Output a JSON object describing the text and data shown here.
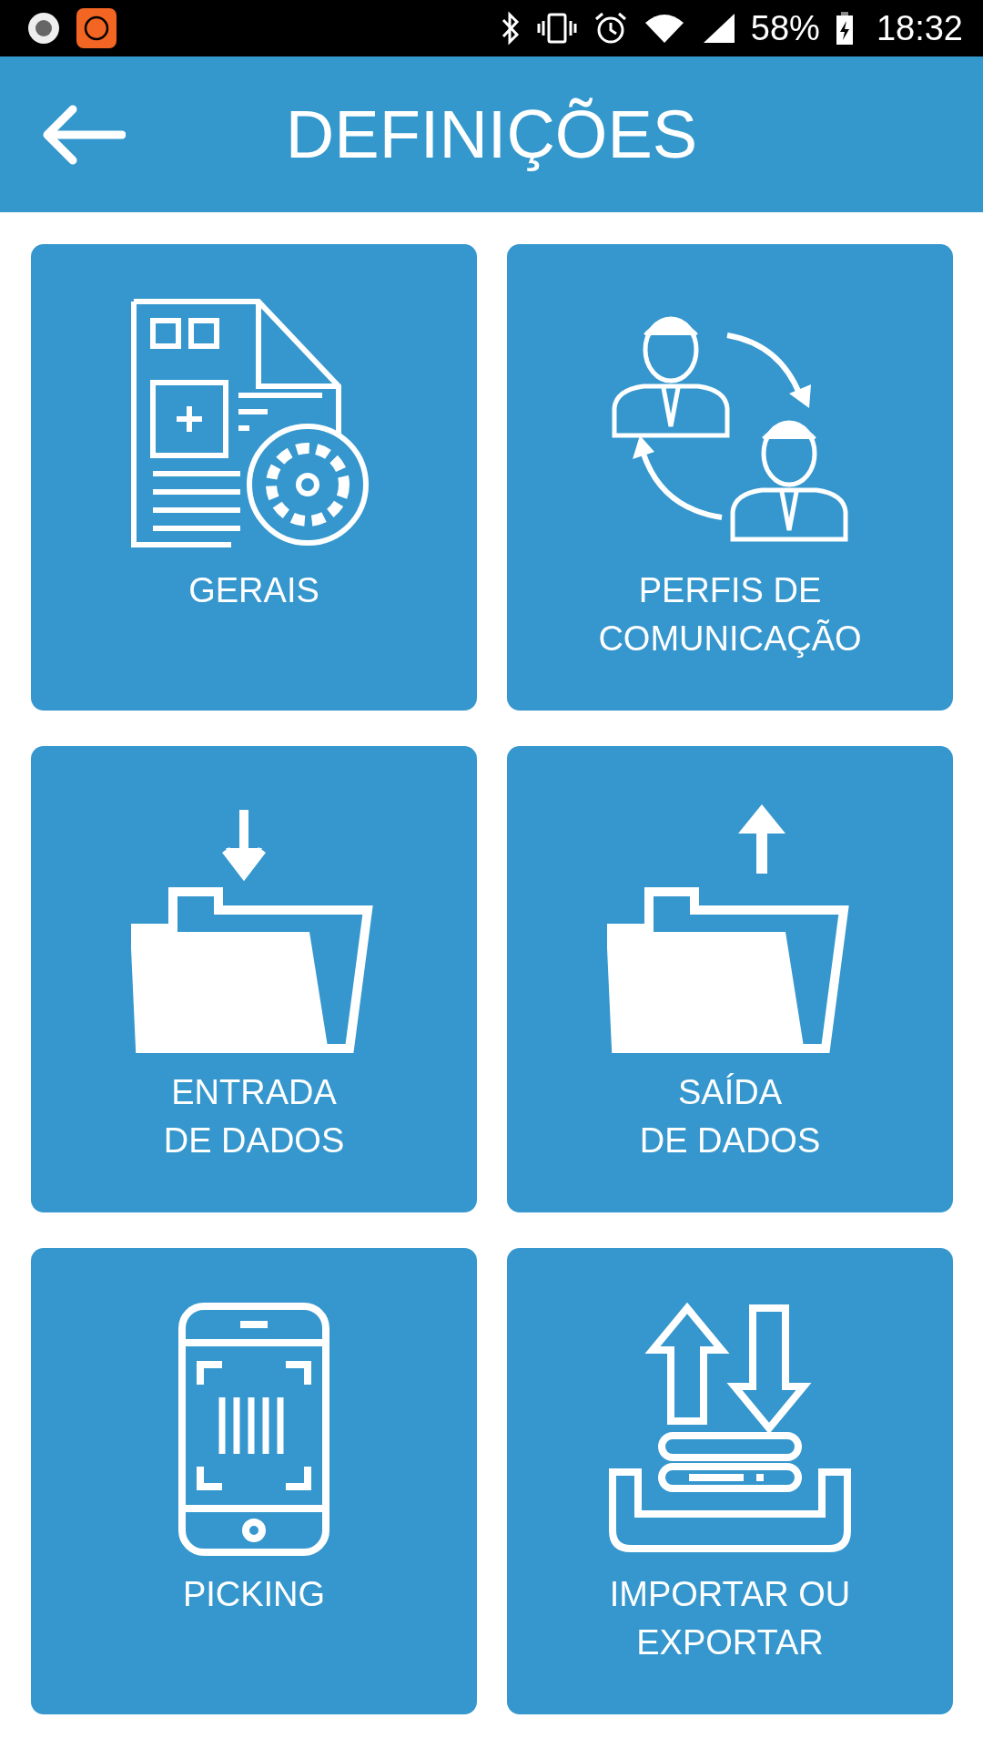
{
  "status_bar": {
    "battery": "58%",
    "time": "18:32"
  },
  "header": {
    "title": "DEFINIÇÕES"
  },
  "tiles": [
    {
      "label": "GERAIS"
    },
    {
      "label": "PERFIS DE\nCOMUNICAÇÃO"
    },
    {
      "label": "ENTRADA\nDE DADOS"
    },
    {
      "label": "SAÍDA\nDE DADOS"
    },
    {
      "label": "PICKING"
    },
    {
      "label": "IMPORTAR OU\nEXPORTAR"
    }
  ]
}
